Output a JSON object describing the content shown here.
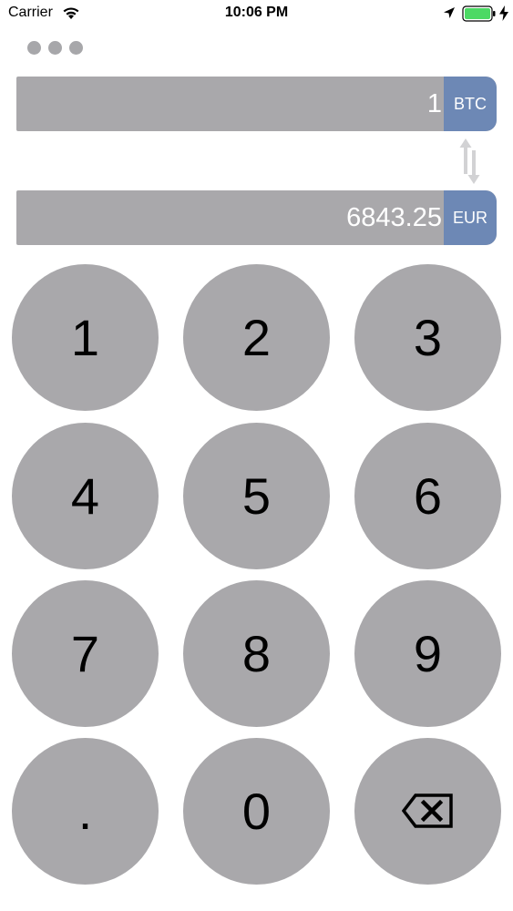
{
  "status_bar": {
    "carrier": "Carrier",
    "time": "10:06 PM",
    "icons": [
      "wifi-icon",
      "location-icon",
      "battery-icon",
      "charging-icon"
    ]
  },
  "menu": {
    "icon": "more-dots-icon"
  },
  "converter": {
    "from": {
      "amount": "1",
      "currency": "BTC"
    },
    "to": {
      "amount": "6843.25",
      "currency": "EUR"
    },
    "swap_icon": "swap-arrows-icon"
  },
  "keypad": {
    "keys": [
      "1",
      "2",
      "3",
      "4",
      "5",
      "6",
      "7",
      "8",
      "9",
      ".",
      "0"
    ],
    "backspace_icon": "backspace-icon"
  },
  "colors": {
    "field_bg": "#a9a8ab",
    "badge_bg": "#6d88b5",
    "key_bg": "#a9a8ab",
    "text_light": "#ffffff"
  }
}
